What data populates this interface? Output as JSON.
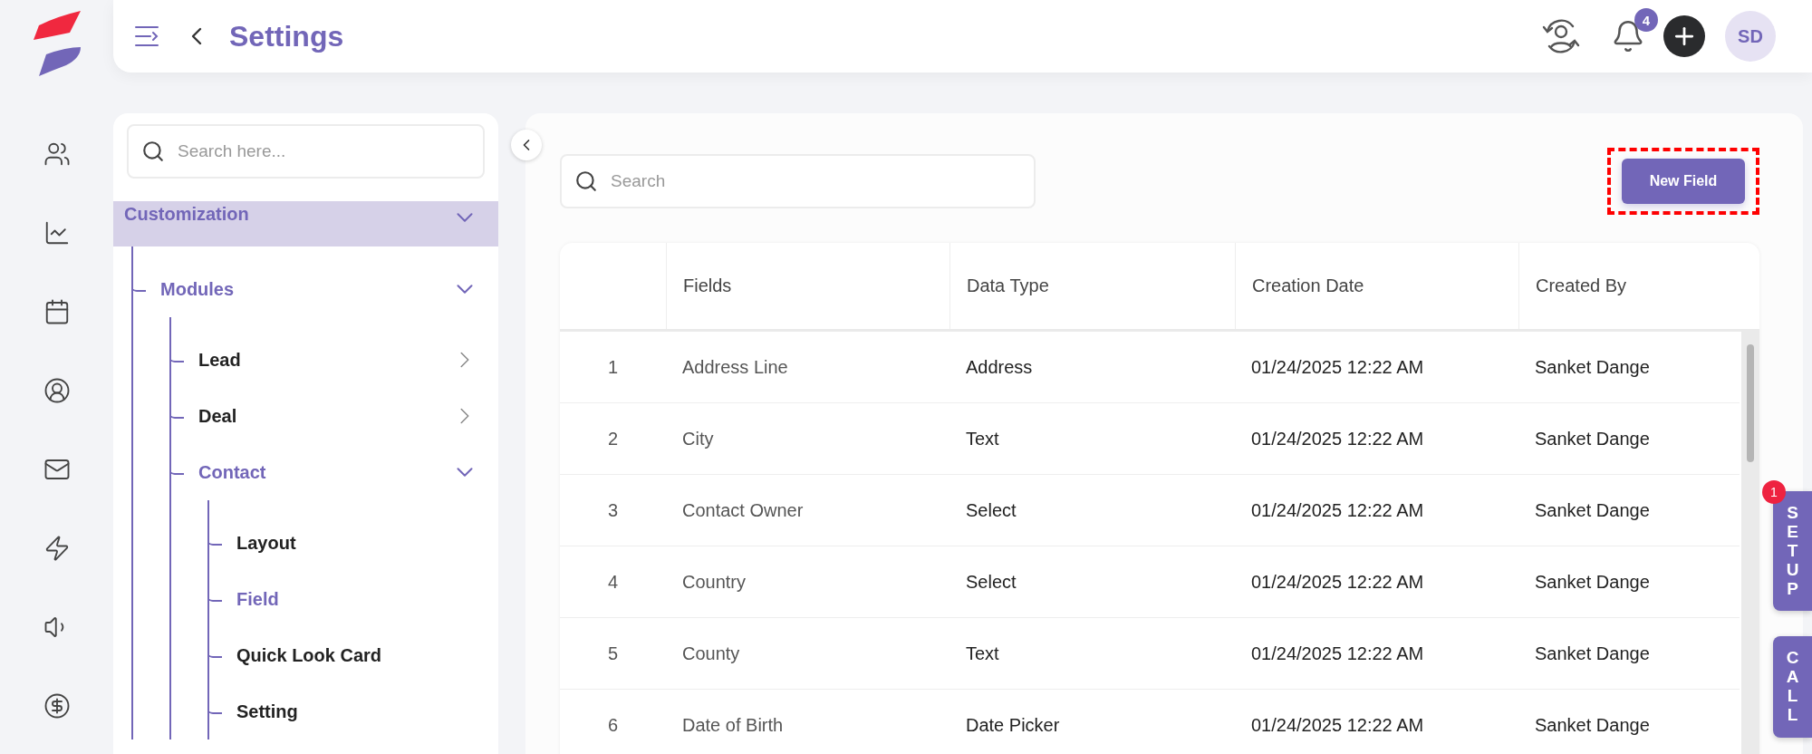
{
  "header": {
    "title": "Settings",
    "notifications": "4",
    "avatar": "SD"
  },
  "sidebar": {
    "search": {
      "placeholder": "Search here..."
    },
    "tree": [
      {
        "label": "Customization",
        "selected": true,
        "expanded": true,
        "children": [
          {
            "label": "Modules",
            "expanded": true,
            "children": [
              {
                "label": "Lead",
                "selected": false,
                "expanded": false
              },
              {
                "label": "Deal",
                "selected": false,
                "expanded": false
              },
              {
                "label": "Contact",
                "expanded": true,
                "children": [
                  {
                    "label": "Layout",
                    "selected": false
                  },
                  {
                    "label": "Field",
                    "selected": true
                  },
                  {
                    "label": "Quick Look Card",
                    "selected": false
                  },
                  {
                    "label": "Setting",
                    "selected": false
                  }
                ]
              }
            ]
          }
        ]
      }
    ]
  },
  "main": {
    "search": {
      "placeholder": "Search"
    },
    "new_button": "New Field",
    "table": {
      "columns": [
        "",
        "Fields",
        "Data Type",
        "Creation Date",
        "Created By"
      ],
      "rows": [
        [
          "1",
          "Address Line",
          "Address",
          "01/24/2025 12:22 AM",
          "Sanket Dange"
        ],
        [
          "2",
          "City",
          "Text",
          "01/24/2025 12:22 AM",
          "Sanket Dange"
        ],
        [
          "3",
          "Contact Owner",
          "Select",
          "01/24/2025 12:22 AM",
          "Sanket Dange"
        ],
        [
          "4",
          "Country",
          "Select",
          "01/24/2025 12:22 AM",
          "Sanket Dange"
        ],
        [
          "5",
          "County",
          "Text",
          "01/24/2025 12:22 AM",
          "Sanket Dange"
        ],
        [
          "6",
          "Date of Birth",
          "Date Picker",
          "01/24/2025 12:22 AM",
          "Sanket Dange"
        ]
      ]
    }
  },
  "side_tabs": [
    {
      "label": "SETUP",
      "badge": "1"
    },
    {
      "label": "CALL"
    }
  ]
}
